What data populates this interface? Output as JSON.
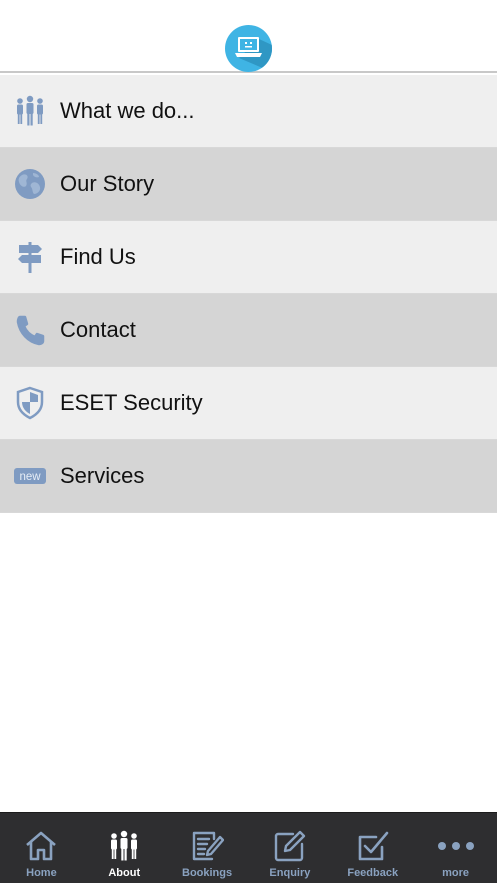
{
  "colors": {
    "accent": "#3fb4e4",
    "icon_blue": "#7f9bc2",
    "tab_inactive": "#8aa2c0",
    "tab_active": "#ffffff",
    "row_light": "#efefef",
    "row_dark": "#d5d5d5",
    "tabbar_bg": "#2e2e30"
  },
  "header": {
    "logo_icon": "laptop-icon"
  },
  "menu": {
    "items": [
      {
        "label": "What we do...",
        "icon": "people-icon"
      },
      {
        "label": "Our Story",
        "icon": "globe-icon"
      },
      {
        "label": "Find Us",
        "icon": "signpost-icon"
      },
      {
        "label": "Contact",
        "icon": "phone-icon"
      },
      {
        "label": "ESET Security",
        "icon": "shield-icon"
      },
      {
        "label": "Services",
        "icon": "new-badge-icon",
        "badge": "new"
      }
    ]
  },
  "tabbar": {
    "active": "About",
    "tabs": [
      {
        "label": "Home",
        "icon": "home-icon"
      },
      {
        "label": "About",
        "icon": "people-icon"
      },
      {
        "label": "Bookings",
        "icon": "notepad-icon"
      },
      {
        "label": "Enquiry",
        "icon": "edit-icon"
      },
      {
        "label": "Feedback",
        "icon": "checkbox-icon"
      },
      {
        "label": "more",
        "icon": "more-dots-icon"
      }
    ]
  }
}
